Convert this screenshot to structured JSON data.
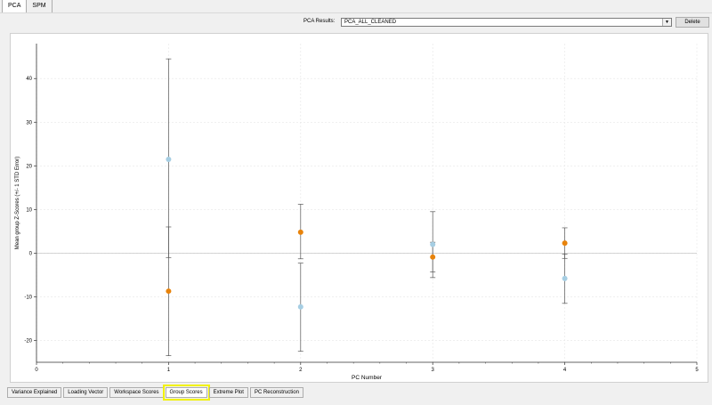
{
  "top_tabs": [
    "PCA",
    "SPM"
  ],
  "pca_results": {
    "label": "PCA Results:",
    "value": "PCA_ALL_CLEANED"
  },
  "delete_label": "Delete",
  "bottom_tabs": [
    "Variance Explained",
    "Loading Vector",
    "Workspace Scores",
    "Group Scores",
    "Extreme Plot",
    "PC Reconstruction"
  ],
  "active_bottom_tab": "Group Scores",
  "colors": {
    "series_blue": "#a6cee3",
    "series_orange": "#e8830b",
    "highlight": "#f2f200"
  },
  "chart_data": {
    "type": "scatter",
    "xlabel": "PC Number",
    "ylabel": "Mean group Z-Scores (+/- 1 STD Error)",
    "xlim": [
      0,
      5
    ],
    "ylim": [
      -25,
      48
    ],
    "xticks": [
      0,
      1,
      2,
      3,
      4,
      5
    ],
    "yticks": [
      -20,
      -10,
      0,
      10,
      20,
      30,
      40
    ],
    "grid": true,
    "series": [
      {
        "color": "#a6cee3",
        "points": [
          {
            "x": 1,
            "y": 21.5,
            "lo": -1,
            "hi": 44.5
          },
          {
            "x": 2,
            "y": -12.3,
            "lo": -22.5,
            "hi": -2.3
          },
          {
            "x": 3,
            "y": 2,
            "lo": -4.3,
            "hi": 2.5
          },
          {
            "x": 4,
            "y": -5.8,
            "lo": -11.5,
            "hi": -0.2
          }
        ]
      },
      {
        "color": "#e8830b",
        "points": [
          {
            "x": 1,
            "y": -8.7,
            "lo": -23.5,
            "hi": 6
          },
          {
            "x": 2,
            "y": 4.8,
            "lo": -1.3,
            "hi": 11.2
          },
          {
            "x": 3,
            "y": -0.9,
            "lo": -5.6,
            "hi": 9.5
          },
          {
            "x": 4,
            "y": 2.3,
            "lo": -1.2,
            "hi": 5.8
          }
        ]
      }
    ]
  }
}
